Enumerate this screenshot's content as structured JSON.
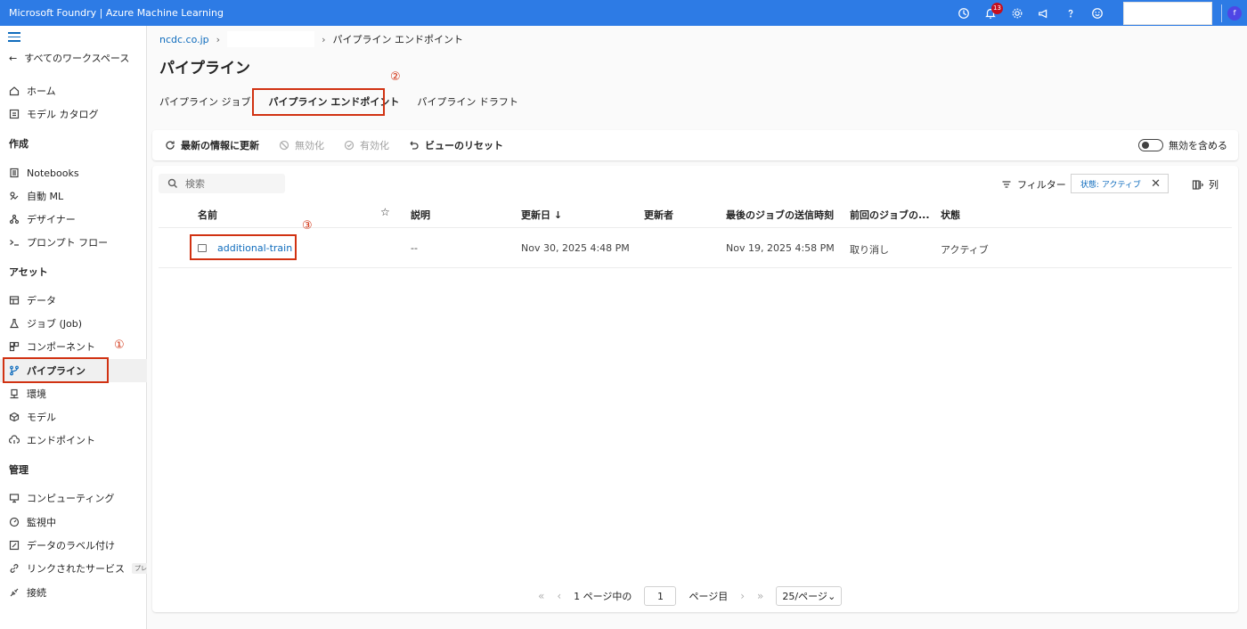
{
  "app": {
    "title": "Microsoft Foundry | Azure Machine Learning",
    "notification_count": "13",
    "avatar_initial": "f"
  },
  "sidebar": {
    "back_label": "すべてのワークスペース",
    "items_top": [
      {
        "label": "ホーム",
        "icon": "home-icon"
      },
      {
        "label": "モデル カタログ",
        "icon": "catalog-icon"
      }
    ],
    "section_create": "作成",
    "items_create": [
      {
        "label": "Notebooks",
        "icon": "notebook-icon"
      },
      {
        "label": "自動 ML",
        "icon": "automl-icon"
      },
      {
        "label": "デザイナー",
        "icon": "designer-icon"
      },
      {
        "label": "プロンプト フロー",
        "icon": "prompt-flow-icon"
      }
    ],
    "section_assets": "アセット",
    "items_assets": [
      {
        "label": "データ",
        "icon": "data-icon"
      },
      {
        "label": "ジョブ (Job)",
        "icon": "flask-icon"
      },
      {
        "label": "コンポーネント",
        "icon": "component-icon"
      },
      {
        "label": "パイプライン",
        "icon": "pipeline-icon"
      },
      {
        "label": "環境",
        "icon": "environment-icon"
      },
      {
        "label": "モデル",
        "icon": "model-icon"
      },
      {
        "label": "エンドポイント",
        "icon": "endpoint-icon"
      }
    ],
    "section_manage": "管理",
    "items_manage": [
      {
        "label": "コンピューティング",
        "icon": "compute-icon"
      },
      {
        "label": "監視中",
        "icon": "monitor-icon"
      },
      {
        "label": "データのラベル付け",
        "icon": "labeling-icon"
      },
      {
        "label": "リンクされたサービス",
        "icon": "link-icon",
        "tag": "プレビュー"
      },
      {
        "label": "接続",
        "icon": "connection-icon"
      }
    ]
  },
  "breadcrumb": {
    "org": "ncdc.co.jp",
    "current": "パイプライン エンドポイント"
  },
  "page_title": "パイプライン",
  "tabs": [
    "パイプライン ジョブ",
    "パイプライン エンドポイント",
    "パイプライン ドラフト"
  ],
  "toolbar": {
    "refresh": "最新の情報に更新",
    "disable": "無効化",
    "enable": "有効化",
    "reset_view": "ビューのリセット",
    "include_disabled": "無効を含める"
  },
  "table": {
    "search_placeholder": "検索",
    "filter_label": "フィルター",
    "filter_chip": "状態: アクティブ",
    "columns_label": "列",
    "headers": [
      "名前",
      "☆",
      "説明",
      "更新日 ↓",
      "更新者",
      "最後のジョブの送信時刻",
      "前回のジョブの...",
      "状態"
    ],
    "rows": [
      {
        "name": "additional-train",
        "description": "--",
        "updated": "Nov 30, 2025 4:48 PM",
        "updated_by": "",
        "last_submit": "Nov 19, 2025 4:58 PM",
        "last_status": "取り消し",
        "state": "アクティブ"
      }
    ]
  },
  "pagination": {
    "of_label": "1 ページ中の",
    "page_value": "1",
    "page_suffix": "ページ目",
    "per_page": "25/ページ"
  },
  "annotations": {
    "m1": "①",
    "m2": "②",
    "m3": "③"
  },
  "colors": {
    "topbar": "#2d7be5",
    "link": "#0f6cbd",
    "highlight": "#d13212"
  }
}
